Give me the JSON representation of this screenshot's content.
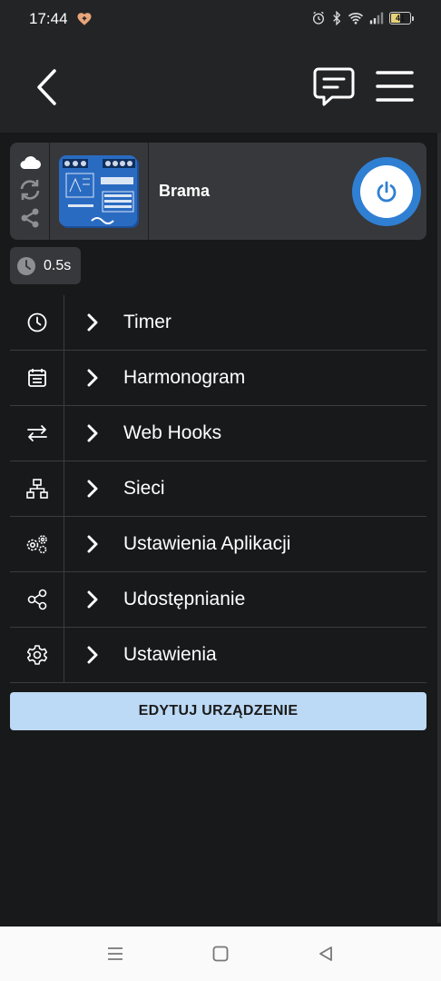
{
  "status_bar": {
    "time": "17:44",
    "battery": "41"
  },
  "device": {
    "name": "Brama",
    "timer": "0.5s"
  },
  "menu": [
    {
      "label": "Timer",
      "icon": "clock-icon"
    },
    {
      "label": "Harmonogram",
      "icon": "calendar-icon"
    },
    {
      "label": "Web Hooks",
      "icon": "arrows-exchange-icon"
    },
    {
      "label": "Sieci",
      "icon": "network-icon"
    },
    {
      "label": "Ustawienia Aplikacji",
      "icon": "gears-icon"
    },
    {
      "label": "Udostępnianie",
      "icon": "share-icon"
    },
    {
      "label": "Ustawienia",
      "icon": "gear-icon"
    }
  ],
  "edit_button": "EDYTUJ URZĄDZENIE",
  "colors": {
    "accent": "#2f7fd3",
    "button_bg": "#bcd9f5",
    "background": "#18191b",
    "card": "#36383b"
  }
}
